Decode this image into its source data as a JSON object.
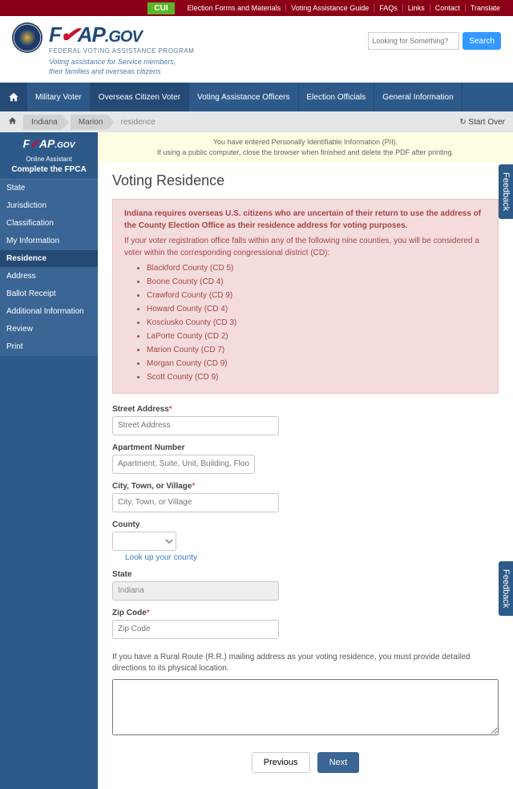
{
  "topNav": [
    "Election Forms and Materials",
    "Voting Assistance Guide",
    "FAQs",
    "Links",
    "Contact",
    "Translate"
  ],
  "cui": "CUI",
  "logo": {
    "main": "FVAP.gov",
    "sub": "FEDERAL VOTING ASSISTANCE PROGRAM"
  },
  "tagline1": "Voting assistance for Service members,",
  "tagline2": "their families and overseas citizens",
  "search": {
    "placeholder": "Looking for Something?",
    "btn": "Search"
  },
  "mainNav": [
    "Military Voter",
    "Overseas Citizen Voter",
    "Voting Assistance Officers",
    "Election Officials",
    "General Information"
  ],
  "breadcrumb": {
    "items": [
      "Indiana",
      "Marion"
    ],
    "text": "residence",
    "startOver": "Start Over"
  },
  "sidebar": {
    "logo": "FVAP.gov",
    "sub": "Online Assistant",
    "title": "Complete the FPCA",
    "items": [
      "State",
      "Jurisdiction",
      "Classification",
      "My Information",
      "Residence",
      "Address",
      "Ballot Receipt",
      "Additional Information",
      "Review",
      "Print"
    ],
    "activeIdx": 4
  },
  "pii": {
    "l1": "You have entered Personally Identifiable Information (PII).",
    "l2": "If using a public computer, close the browser when finished and delete the PDF after printing."
  },
  "pageTitle": "Voting Residence",
  "alert": {
    "bold": "Indiana requires overseas U.S. citizens who are uncertain of their return to use the address of the County Election Office as their residence address for voting purposes.",
    "text": "If your voter registration office falls within any of the following nine counties, you will be considered a voter within the corresponding congressional district (CD):",
    "counties": [
      "Blackford County (CD 5)",
      "Boone County (CD 4)",
      "Crawford County (CD 9)",
      "Howard County (CD 4)",
      "Kosciusko County (CD 3)",
      "LaPorte County (CD 2)",
      "Marion County (CD 7)",
      "Morgan County (CD 9)",
      "Scott County (CD 9)"
    ]
  },
  "fields": {
    "street": {
      "label": "Street Address",
      "ph": "Street Address"
    },
    "apt": {
      "label": "Apartment Number",
      "ph": "Apartment, Suite, Unit, Building, Floor, etc."
    },
    "city": {
      "label": "City, Town, or Village",
      "ph": "City, Town, or Village"
    },
    "county": {
      "label": "County",
      "link": "Look up your county"
    },
    "state": {
      "label": "State",
      "value": "Indiana"
    },
    "zip": {
      "label": "Zip Code",
      "ph": "Zip Code"
    }
  },
  "rrText": "If you have a Rural Route (R.R.) mailing address as your voting residence, you must provide detailed directions to its physical location.",
  "buttons": {
    "prev": "Previous",
    "next": "Next"
  },
  "feedback": "Feedback"
}
